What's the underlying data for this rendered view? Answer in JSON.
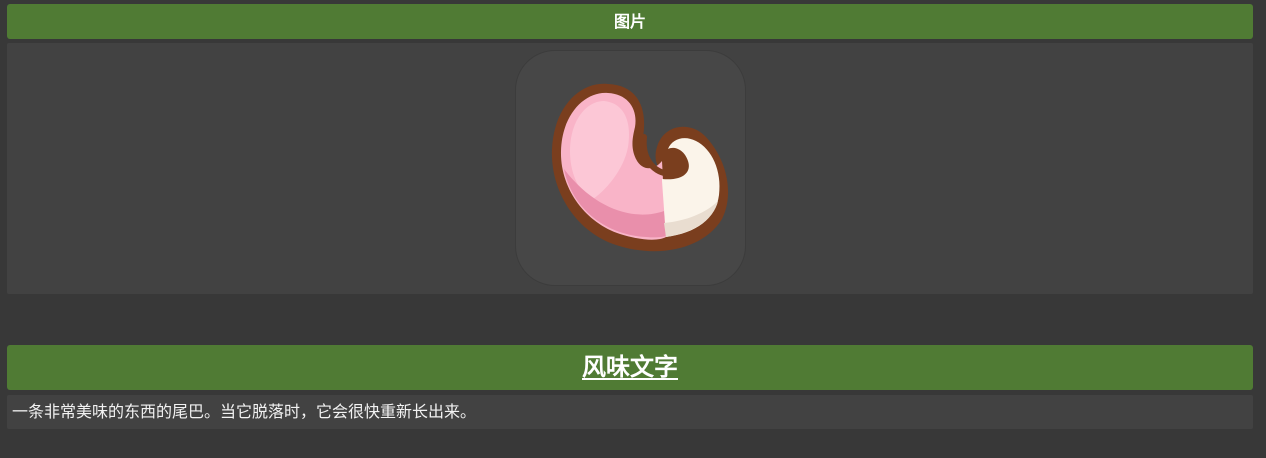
{
  "image_section": {
    "header": "图片",
    "icon": "pink-tail-icon"
  },
  "flavor_section": {
    "header": "风味文字",
    "text": "一条非常美味的东西的尾巴。当它脱落时，它会很快重新长出来。"
  },
  "colors": {
    "background": "#383838",
    "panel": "#424242",
    "header_green": "#507b34",
    "text": "#ffffff"
  }
}
